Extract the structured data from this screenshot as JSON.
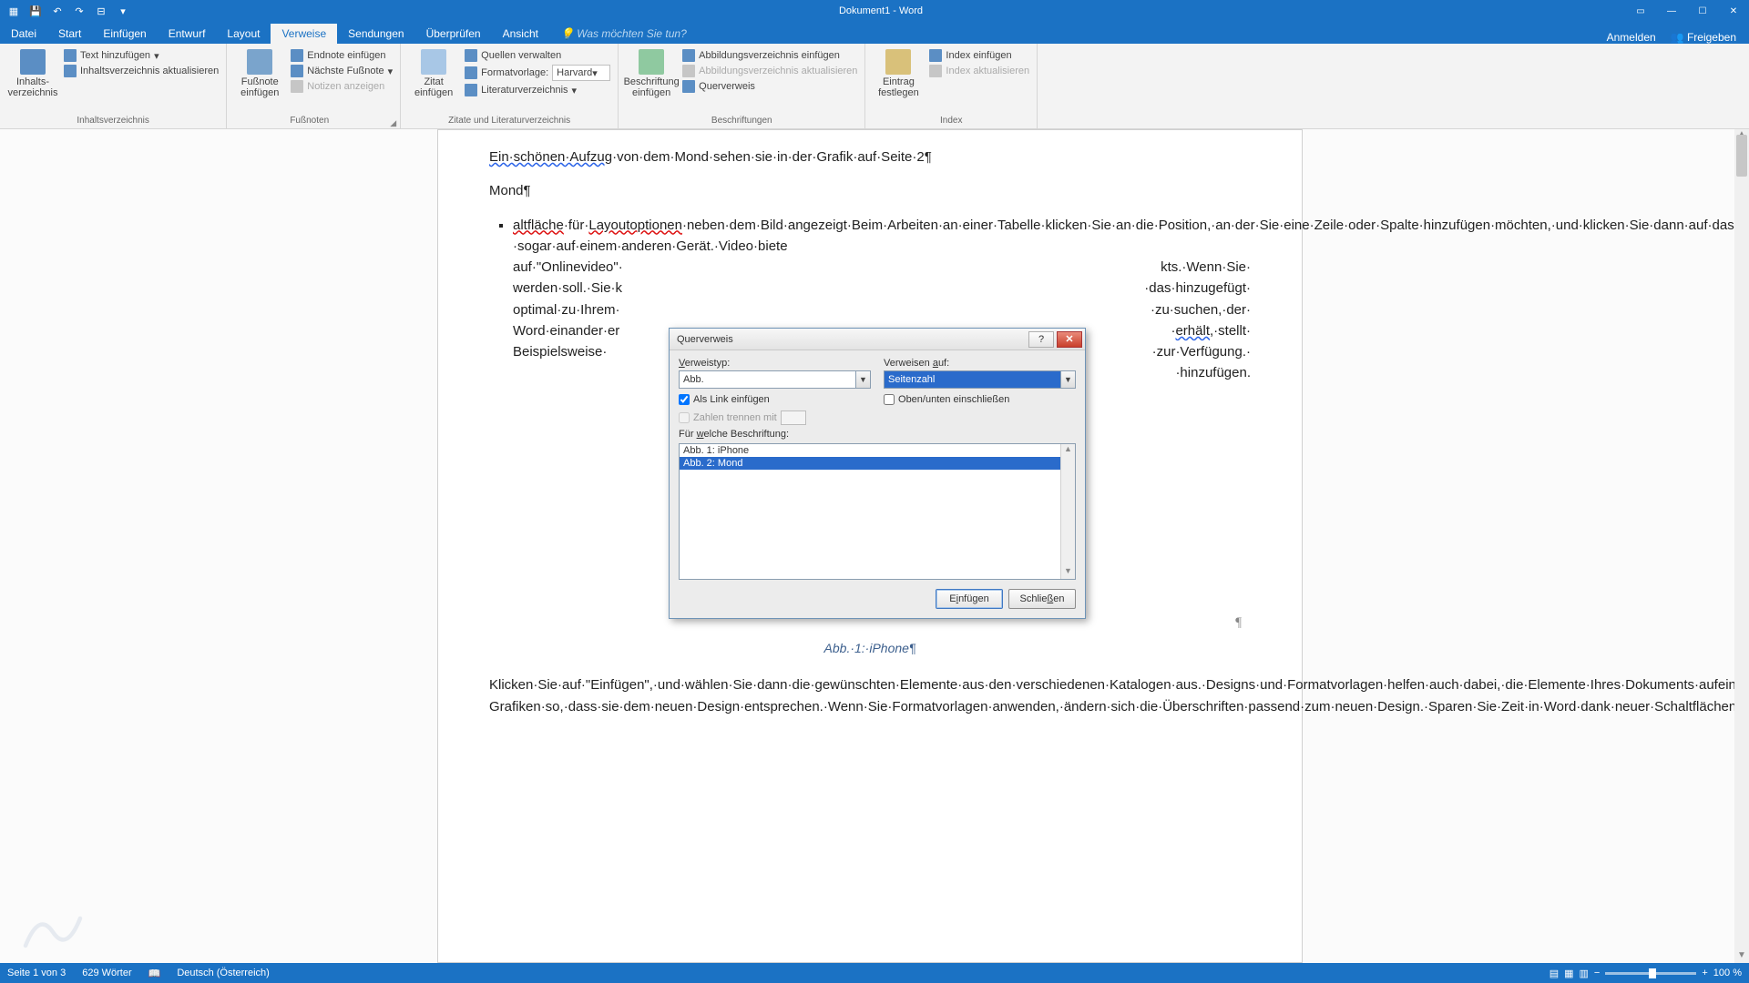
{
  "titlebar": {
    "title": "Dokument1 - Word"
  },
  "tabs": {
    "datei": "Datei",
    "start": "Start",
    "einfuegen": "Einfügen",
    "entwurf": "Entwurf",
    "layout": "Layout",
    "verweise": "Verweise",
    "sendungen": "Sendungen",
    "ueberpruefen": "Überprüfen",
    "ansicht": "Ansicht",
    "tellme": "Was möchten Sie tun?",
    "anmelden": "Anmelden",
    "freigeben": "Freigeben"
  },
  "ribbon": {
    "toc": {
      "big": "Inhalts-\nverzeichnis",
      "add_text": "Text hinzufügen",
      "update": "Inhaltsverzeichnis aktualisieren",
      "group": "Inhaltsverzeichnis"
    },
    "footnotes": {
      "big": "Fußnote\neinfügen",
      "endnote": "Endnote einfügen",
      "next": "Nächste Fußnote",
      "show": "Notizen anzeigen",
      "group": "Fußnoten"
    },
    "citations": {
      "big": "Zitat\neinfügen",
      "manage": "Quellen verwalten",
      "style_label": "Formatvorlage:",
      "style_value": "Harvard",
      "biblio": "Literaturverzeichnis",
      "group": "Zitate und Literaturverzeichnis"
    },
    "captions": {
      "big": "Beschriftung\neinfügen",
      "insert_fig": "Abbildungsverzeichnis einfügen",
      "update_fig": "Abbildungsverzeichnis aktualisieren",
      "crossref": "Querverweis",
      "group": "Beschriftungen"
    },
    "index": {
      "big": "Eintrag\nfestlegen",
      "insert": "Index einfügen",
      "update": "Index aktualisieren",
      "group": "Index"
    }
  },
  "doc": {
    "line1_a": "Ein·schönen·Aufzug",
    "line1_b": "·von·dem·Mond·sehen·sie·in·der·Grafik·auf·Seite·2¶",
    "line2": "Mond¶",
    "para_a": "altfläche",
    "para_b": "·für·",
    "para_c": "Layoutoptionen",
    "para_d": "·neben·dem·Bild·angezeigt·Beim·Arbeiten·an·einer·Tabelle·klicken·Sie·an·die·Position,·an·der·Sie·eine·Zeile·oder·Spalte·hinzufügen·möchten,·und·klicken·Sie·dann·auf·das·Pluszeichen.·Auch·das·Lesen·ist·bequemer·in·der·neuen·Leseansicht.·Sie·können·Teile·des·Dokuments·reduzieren·und·sich·auf·den·gewünschten·Text·konzentrieren.·Wenn·Sie·vor·dem·Ende·zu·lesen·aufhören·müssen,·merkt·sich·Word·die·Stelle,·bis·zu·der·Sie·gelangt·sind·–·sogar·auf·einem·anderen·Gerät.·Video·biete",
    "para_right1": "kts.·Wenn·Sie·",
    "para_left1": "auf·\"Onlinevideo\"·",
    "para_right2": "·das·hinzugefügt·",
    "para_left2": "werden·soll.·Sie·k",
    "para_right3": "·zu·suchen,·der·",
    "para_left3": "optimal·zu·Ihrem·",
    "para_right4_a": "·",
    "para_right4_b": "erhält",
    "para_right4_c": ",·stellt·",
    "para_left4": "Word·einander·er",
    "para_right5": "·zur·Verfügung.·",
    "para_left5": "Beispielsweise·",
    "para_right6": "·hinzufügen.",
    "caption": "Abb.·1:·iPhone¶",
    "para2": "Klicken·Sie·auf·\"Einfügen\",·und·wählen·Sie·dann·die·gewünschten·Elemente·aus·den·verschiedenen·Katalogen·aus.·Designs·und·Formatvorlagen·helfen·auch·dabei,·die·Elemente·Ihres·Dokuments·aufeinander·abzustimmen.·Wenn·Sie·auf·\"Design\"·klicken·und·ein·neues·Design·auswählen,·ändern·sich·die·Grafiken,·Diagramme·und·SmartArt-Grafiken·so,·dass·sie·dem·neuen·Design·entsprechen.·Wenn·Sie·Formatvorlagen·anwenden,·ändern·sich·die·Überschriften·passend·zum·neuen·Design.·Sparen·Sie·Zeit·in·Word·dank·neuer·Schaltflächen,·die·angezeigt·werden,·wo·Sie·sie·benötigen.·Zum·Ändern·der·Weise,·in·der·sich·ein·Bild·in·Ihr·Dokument·einfügt,·klicken·Sie·auf·das·Bild.·Dann·wird·"
  },
  "dialog": {
    "title": "Querverweis",
    "ref_type_label": "Verweistyp:",
    "ref_type_value": "Abb.",
    "ref_to_label": "Verweisen auf:",
    "ref_to_value": "Seitenzahl",
    "as_link": "Als Link einfügen",
    "above_below": "Oben/unten einschließen",
    "sep_numbers": "Zahlen trennen mit",
    "for_which": "Für welche Beschriftung:",
    "items": [
      "Abb. 1: iPhone",
      "Abb. 2: Mond"
    ],
    "insert": "Einfügen",
    "close": "Schließen"
  },
  "status": {
    "page": "Seite 1 von 3",
    "words": "629 Wörter",
    "lang": "Deutsch (Österreich)",
    "zoom": "100 %"
  }
}
